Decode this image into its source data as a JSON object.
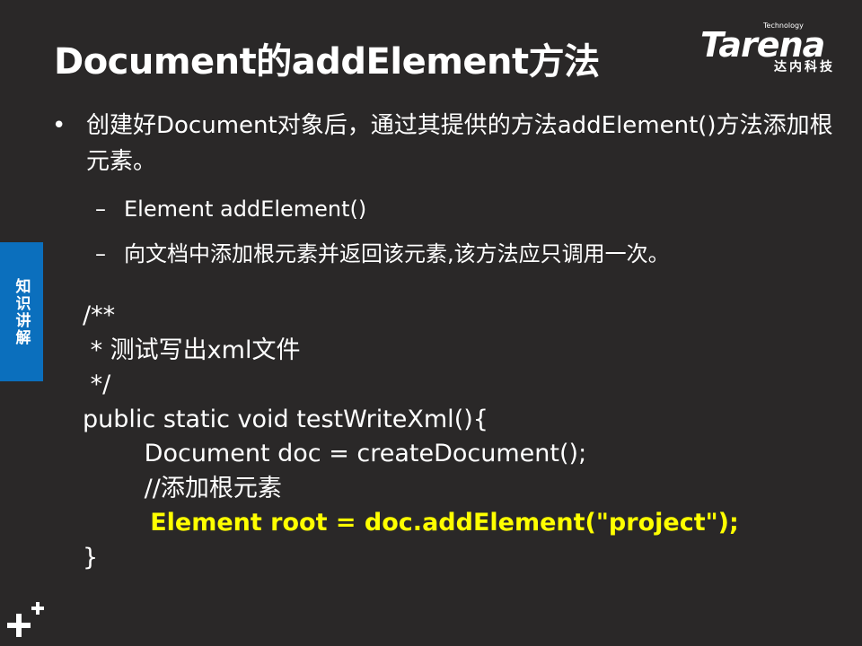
{
  "title": "Document的addElement方法",
  "logo": {
    "small": "Technology",
    "word": "Tarena",
    "cn": "达内科技"
  },
  "side_tab": "知识讲解",
  "bullets": {
    "main": "创建好Document对象后，通过其提供的方法addElement()方法添加根元素。",
    "sub1": "Element addElement()",
    "sub2": "向文档中添加根元素并返回该元素,该方法应只调用一次。"
  },
  "code": {
    "l1": "/**",
    "l2": " * 测试写出xml文件",
    "l3": " */",
    "l4": "public static void testWriteXml(){",
    "l5": "        Document doc = createDocument();",
    "l6": "        //添加根元素",
    "l7": "        Element root = doc.addElement(\"project\");",
    "l8": "}"
  },
  "colors": {
    "background": "#2a2828",
    "highlight": "#ffff00",
    "side_tab": "#0b6fbd"
  },
  "icons": [
    "plus-icon"
  ]
}
